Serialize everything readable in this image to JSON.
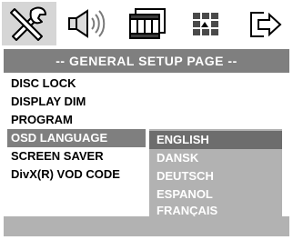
{
  "icons": [
    {
      "name": "general-setup-icon",
      "selected": true
    },
    {
      "name": "audio-setup-icon",
      "selected": false
    },
    {
      "name": "video-setup-icon",
      "selected": false
    },
    {
      "name": "preference-setup-icon",
      "selected": false
    },
    {
      "name": "exit-icon",
      "selected": false
    }
  ],
  "title": "-- GENERAL SETUP PAGE --",
  "menu": {
    "items": [
      "DISC LOCK",
      "DISPLAY DIM",
      "PROGRAM",
      "OSD LANGUAGE",
      "SCREEN SAVER",
      "DivX(R) VOD CODE"
    ],
    "selected": "OSD LANGUAGE"
  },
  "submenu": {
    "items": [
      "ENGLISH",
      "DANSK",
      "DEUTSCH",
      "ESPANOL",
      "FRANÇAIS"
    ],
    "selected": "ENGLISH"
  },
  "colors": {
    "highlight": "#7f7f7f",
    "submenu_bg": "#b2b2b2"
  }
}
